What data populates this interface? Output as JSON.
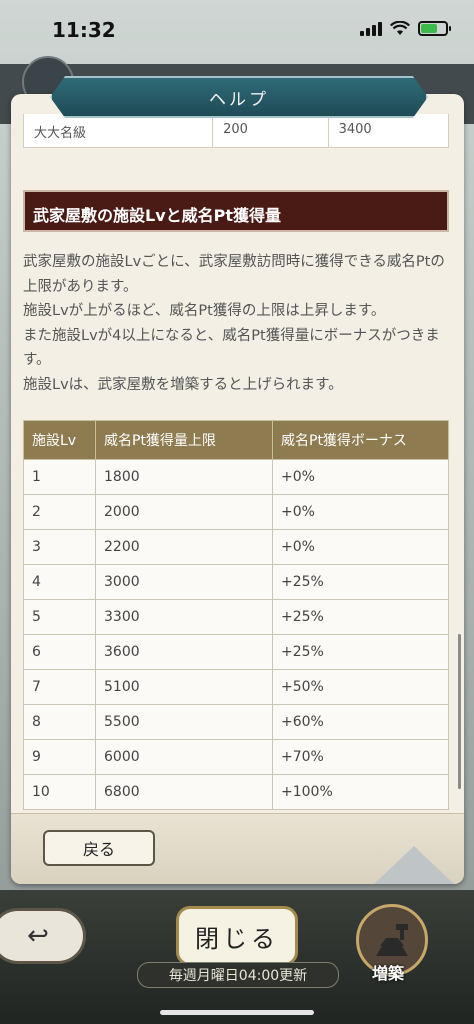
{
  "status_bar": {
    "time": "11:32"
  },
  "dialog": {
    "title": "ヘルプ",
    "prev_table_row": [
      "大大名級",
      "200",
      "3400"
    ],
    "section_title": "武家屋敷の施設Lvと威名Pt獲得量",
    "description": [
      "武家屋敷の施設Lvごとに、武家屋敷訪問時に獲得できる威名Ptの上限があります。",
      "施設Lvが上がるほど、威名Pt獲得の上限は上昇します。",
      "また施設Lvが4以上になると、威名Pt獲得量にボーナスがつきます。",
      "施設Lvは、武家屋敷を増築すると上げられます。"
    ],
    "table": {
      "headers": [
        "施設Lv",
        "威名Pt獲得量上限",
        "威名Pt獲得ボーナス"
      ],
      "rows": [
        [
          "1",
          "1800",
          "+0%"
        ],
        [
          "2",
          "2000",
          "+0%"
        ],
        [
          "3",
          "2200",
          "+0%"
        ],
        [
          "4",
          "3000",
          "+25%"
        ],
        [
          "5",
          "3300",
          "+25%"
        ],
        [
          "6",
          "3600",
          "+25%"
        ],
        [
          "7",
          "5100",
          "+50%"
        ],
        [
          "8",
          "5500",
          "+60%"
        ],
        [
          "9",
          "6000",
          "+70%"
        ],
        [
          "10",
          "6800",
          "+100%"
        ]
      ]
    },
    "back_label": "戻る"
  },
  "bottom_bar": {
    "close_label": "閉じる",
    "weekly_note": "毎週月曜日04:00更新",
    "build_label": "増築"
  },
  "colors": {
    "section_header_bg": "#4a1a14",
    "table_header_bg": "#8e7b50",
    "title_banner": "#2f6b78"
  }
}
